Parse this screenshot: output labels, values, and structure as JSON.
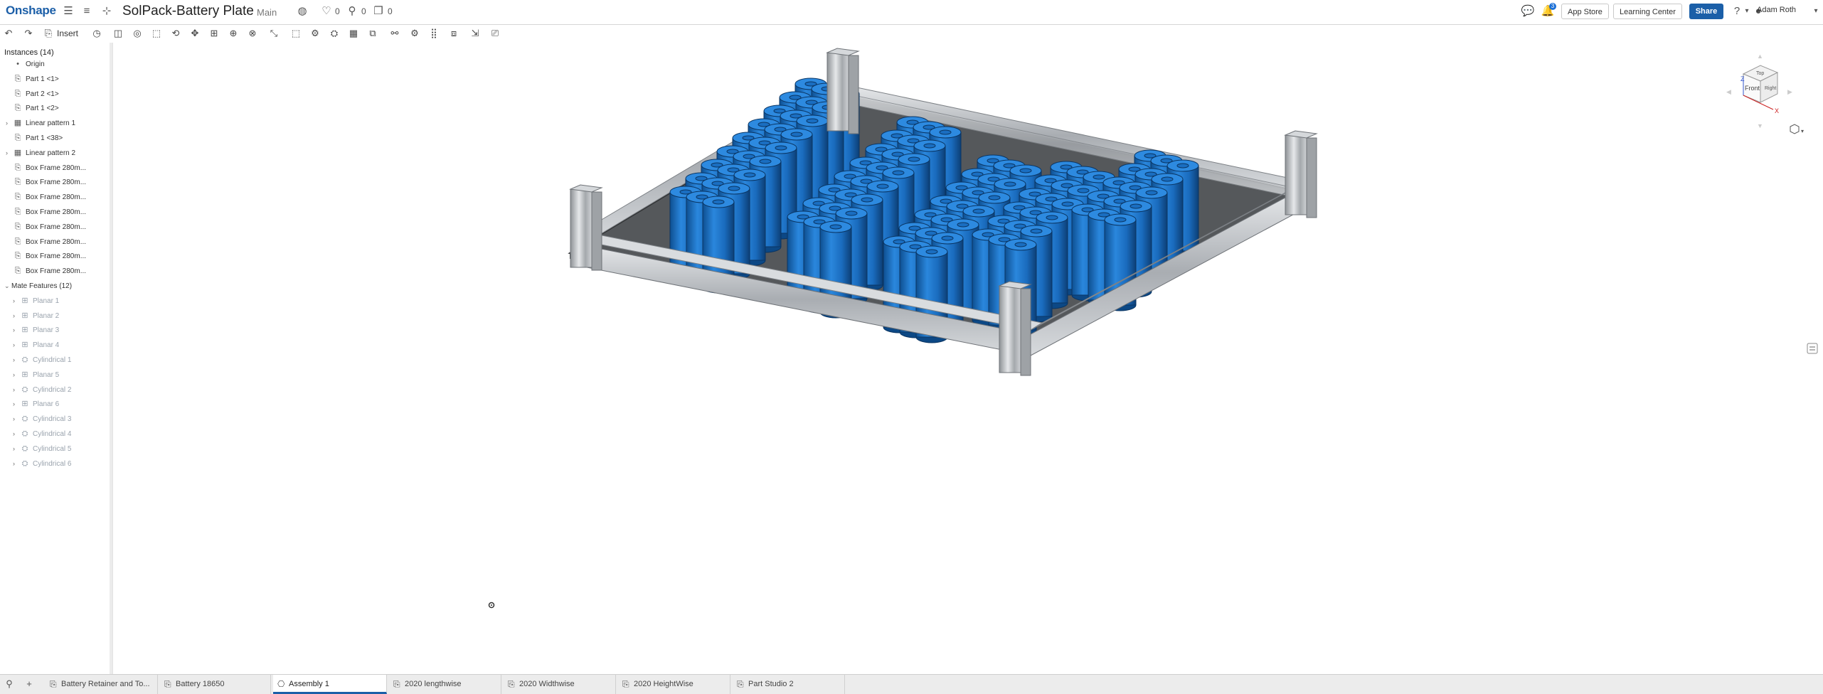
{
  "app": {
    "logo": "Onshape"
  },
  "document": {
    "title": "SolPack-Battery Plate",
    "branch": "Main",
    "likes": "0",
    "links": "0",
    "copies": "0"
  },
  "header_right": {
    "app_store": "App Store",
    "learning_center": "Learning Center",
    "share": "Share",
    "user": "Adam Roth",
    "notifications_count": "3",
    "help": "?"
  },
  "toolbar": {
    "insert_label": "Insert"
  },
  "sidebar": {
    "instances_header": "Instances (14)",
    "items": [
      {
        "label": "Origin",
        "icon": "origin-icon",
        "dim": false
      },
      {
        "label": "Part 1 <1>",
        "icon": "part-icon",
        "dim": false
      },
      {
        "label": "Part 2 <1>",
        "icon": "part-icon",
        "dim": false
      },
      {
        "label": "Part 1 <2>",
        "icon": "part-icon",
        "dim": false
      },
      {
        "label": "Linear pattern 1",
        "icon": "pattern-icon",
        "dim": false,
        "expandable": true
      },
      {
        "label": "Part 1 <38>",
        "icon": "part-icon",
        "dim": false
      },
      {
        "label": "Linear pattern 2",
        "icon": "pattern-icon",
        "dim": false,
        "expandable": true
      },
      {
        "label": "Box Frame 280m...",
        "icon": "part-icon",
        "dim": false
      },
      {
        "label": "Box Frame 280m...",
        "icon": "part-icon",
        "dim": false
      },
      {
        "label": "Box Frame 280m...",
        "icon": "part-icon",
        "dim": false
      },
      {
        "label": "Box Frame 280m...",
        "icon": "part-icon",
        "dim": false
      },
      {
        "label": "Box Frame 280m...",
        "icon": "part-icon",
        "dim": false
      },
      {
        "label": "Box Frame 280m...",
        "icon": "part-icon",
        "dim": false
      },
      {
        "label": "Box Frame 280m...",
        "icon": "part-icon",
        "dim": false
      },
      {
        "label": "Box Frame 280m...",
        "icon": "part-icon",
        "dim": false
      }
    ],
    "mate_header": "Mate Features (12)",
    "mates": [
      {
        "label": "Planar 1",
        "icon": "planar-mate-icon"
      },
      {
        "label": "Planar 2",
        "icon": "planar-mate-icon"
      },
      {
        "label": "Planar 3",
        "icon": "planar-mate-icon"
      },
      {
        "label": "Planar 4",
        "icon": "planar-mate-icon"
      },
      {
        "label": "Cylindrical 1",
        "icon": "cylindrical-mate-icon"
      },
      {
        "label": "Planar 5",
        "icon": "planar-mate-icon"
      },
      {
        "label": "Cylindrical 2",
        "icon": "cylindrical-mate-icon"
      },
      {
        "label": "Planar 6",
        "icon": "planar-mate-icon"
      },
      {
        "label": "Cylindrical 3",
        "icon": "cylindrical-mate-icon"
      },
      {
        "label": "Cylindrical 4",
        "icon": "cylindrical-mate-icon"
      },
      {
        "label": "Cylindrical 5",
        "icon": "cylindrical-mate-icon"
      },
      {
        "label": "Cylindrical 6",
        "icon": "cylindrical-mate-icon"
      }
    ]
  },
  "viewcube": {
    "top": "Top",
    "front": "Front",
    "right": "Right",
    "axis_z": "Z",
    "axis_x": "X"
  },
  "tabs": [
    {
      "label": "Battery Retainer and To...",
      "icon": "part-studio-icon",
      "active": false
    },
    {
      "label": "Battery 18650",
      "icon": "part-studio-icon",
      "active": false
    },
    {
      "label": "Assembly 1",
      "icon": "assembly-icon",
      "active": true
    },
    {
      "label": "2020 lengthwise",
      "icon": "part-studio-icon",
      "active": false
    },
    {
      "label": "2020 Widthwise",
      "icon": "part-studio-icon",
      "active": false
    },
    {
      "label": "2020 HeightWise",
      "icon": "part-studio-icon",
      "active": false
    },
    {
      "label": "Part Studio 2",
      "icon": "part-studio-icon",
      "active": false
    }
  ],
  "colors": {
    "brand": "#1b5fa8",
    "battery": "#1f77c9",
    "frame": "#b8bcc0",
    "plate": "#4a4d50"
  }
}
